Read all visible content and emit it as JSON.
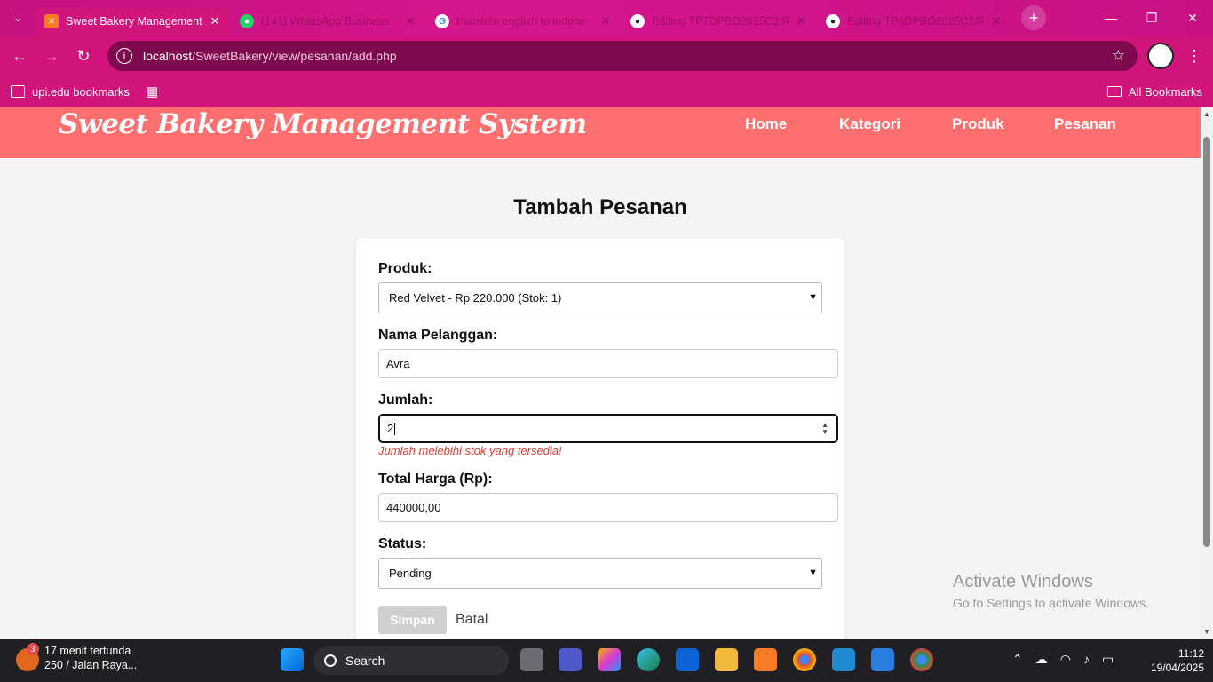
{
  "browser": {
    "tabs": [
      {
        "title": "Sweet Bakery Management S",
        "active": true,
        "icon": "xampp-icon"
      },
      {
        "title": "(141) WhatsApp Business",
        "active": false,
        "icon": "whatsapp-icon"
      },
      {
        "title": "translate english to indone",
        "active": false,
        "icon": "google-icon"
      },
      {
        "title": "Editing TP7DPBO2025C2/R",
        "active": false,
        "icon": "github-icon"
      },
      {
        "title": "Editing TP6DPBO2025C2/R",
        "active": false,
        "icon": "github-icon"
      }
    ],
    "url_host": "localhost",
    "url_path": "/SweetBakery/view/pesanan/add.php",
    "bookmark": "upi.edu bookmarks",
    "all_bookmarks": "All Bookmarks",
    "accent": "#d2157d"
  },
  "site": {
    "logo": "Sweet Bakery Management System",
    "nav": [
      "Home",
      "Kategori",
      "Produk",
      "Pesanan"
    ],
    "header_color": "#ff6f6f"
  },
  "form": {
    "title": "Tambah Pesanan",
    "produk_label": "Produk:",
    "produk_value": "Red Velvet - Rp 220.000 (Stok: 1)",
    "nama_label": "Nama Pelanggan:",
    "nama_value": "Avra",
    "jumlah_label": "Jumlah:",
    "jumlah_value": "2",
    "jumlah_error": "Jumlah melebihi stok yang tersedia!",
    "total_label": "Total Harga (Rp):",
    "total_value": "440000,00",
    "status_label": "Status:",
    "status_value": "Pending",
    "save_label": "Simpan",
    "cancel_label": "Batal"
  },
  "watermark": {
    "line1": "Activate Windows",
    "line2": "Go to Settings to activate Windows."
  },
  "taskbar": {
    "weather_badge": "3",
    "weather_line1": "17 menit tertunda",
    "weather_line2": "250 / Jalan Raya...",
    "search_label": "Search",
    "time": "11:12",
    "date": "19/04/2025"
  }
}
